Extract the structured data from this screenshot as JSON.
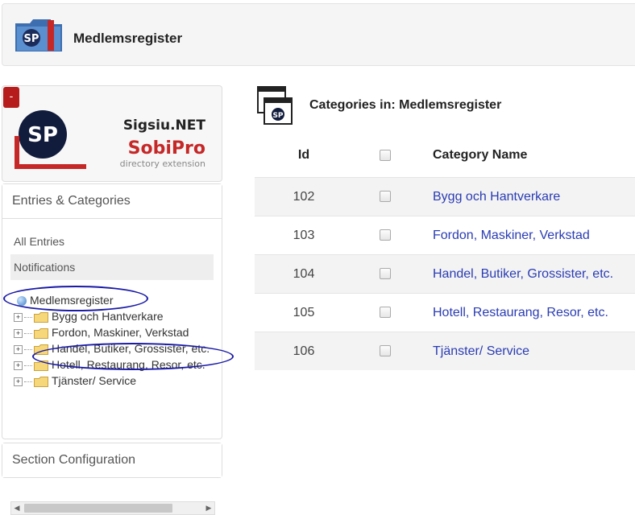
{
  "header": {
    "title": "Medlemsregister",
    "icon": "sobipro-folder-icon"
  },
  "sidebar": {
    "collapse_label": "-",
    "logo": {
      "brand": "Sigsiu.NET",
      "product": "SobiPro",
      "tagline": "directory extension"
    },
    "entries_section_title": "Entries & Categories",
    "nav": [
      {
        "label": "All Entries"
      },
      {
        "label": "Notifications"
      }
    ],
    "tree": {
      "root": "Medlemsregister",
      "items": [
        {
          "label": "Bygg och Hantverkare"
        },
        {
          "label": "Fordon, Maskiner, Verkstad"
        },
        {
          "label": "Handel, Butiker, Grossister, etc."
        },
        {
          "label": "Hotell, Restaurang, Resor, etc."
        },
        {
          "label": "Tjänster/ Service"
        }
      ]
    },
    "config_section_title": "Section Configuration"
  },
  "main": {
    "title": "Categories in: Medlemsregister",
    "columns": {
      "id": "Id",
      "name": "Category Name"
    },
    "rows": [
      {
        "id": "102",
        "name": "Bygg och Hantverkare"
      },
      {
        "id": "103",
        "name": "Fordon, Maskiner, Verkstad"
      },
      {
        "id": "104",
        "name": "Handel, Butiker, Grossister, etc."
      },
      {
        "id": "105",
        "name": "Hotell, Restaurang, Resor, etc."
      },
      {
        "id": "106",
        "name": "Tjänster/ Service"
      }
    ]
  },
  "colors": {
    "link": "#2a3cb4",
    "annotation": "#1a1aa6",
    "collapse": "#b71c1c"
  }
}
